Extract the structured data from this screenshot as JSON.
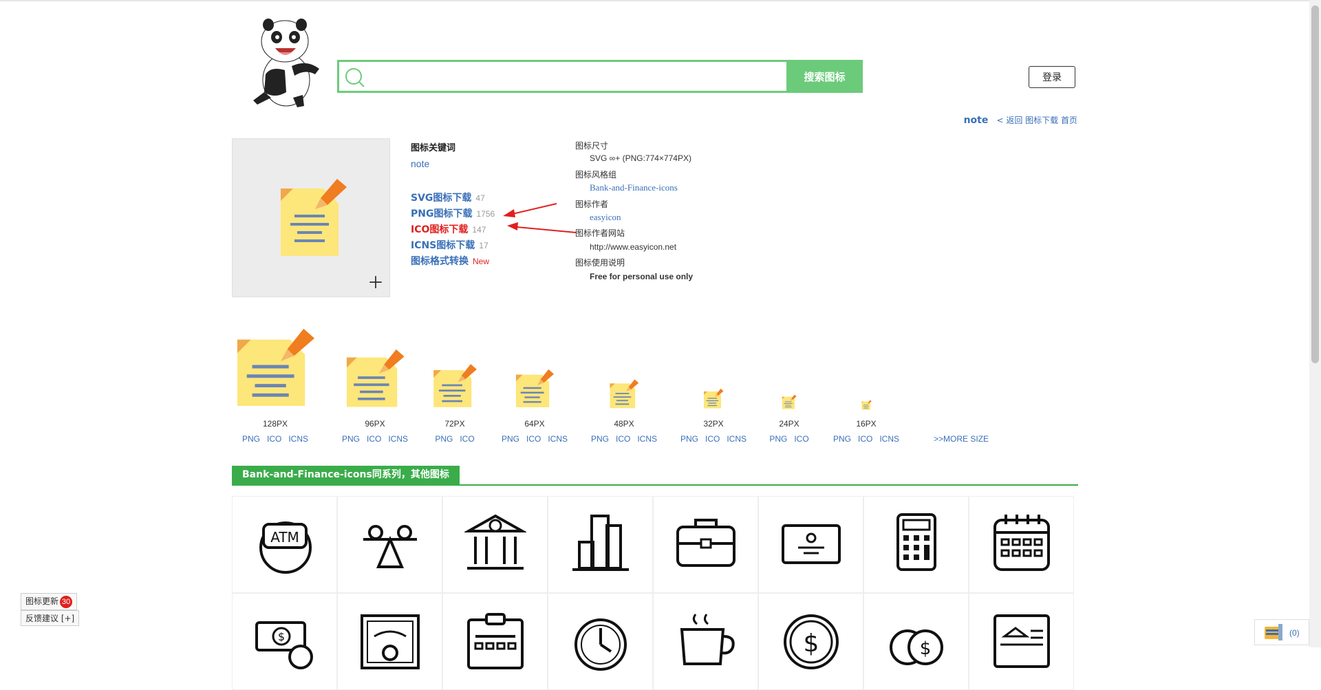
{
  "search": {
    "placeholder": "",
    "button_label": "搜索图标"
  },
  "header": {
    "login_label": "登录"
  },
  "breadcrumb": {
    "keyword": "note",
    "back_label": "< 返回 图标下载 首页"
  },
  "keyword_section": {
    "title": "图标关键词",
    "value": "note",
    "downloads": [
      {
        "label": "SVG图标下载",
        "count": "47"
      },
      {
        "label": "PNG图标下载",
        "count": "1756"
      },
      {
        "label": "ICO图标下载",
        "count": "147"
      },
      {
        "label": "ICNS图标下载",
        "count": "17"
      },
      {
        "label": "图标格式转换",
        "count": "New"
      }
    ]
  },
  "info": {
    "size_label": "图标尺寸",
    "size_value": "SVG ∞+ (PNG:774×774PX)",
    "style_label": "图标风格组",
    "style_value": "Bank-and-Finance-icons",
    "author_label": "图标作者",
    "author_value": "easyicon",
    "site_label": "图标作者网站",
    "site_value": "http://www.easyicon.net",
    "usage_label": "图标使用说明",
    "usage_value": "Free for personal use only"
  },
  "sizes": [
    {
      "label": "128PX",
      "formats": [
        "PNG",
        "ICO",
        "ICNS"
      ]
    },
    {
      "label": "96PX",
      "formats": [
        "PNG",
        "ICO",
        "ICNS"
      ]
    },
    {
      "label": "72PX",
      "formats": [
        "PNG",
        "ICO"
      ]
    },
    {
      "label": "64PX",
      "formats": [
        "PNG",
        "ICO",
        "ICNS"
      ]
    },
    {
      "label": "48PX",
      "formats": [
        "PNG",
        "ICO",
        "ICNS"
      ]
    },
    {
      "label": "32PX",
      "formats": [
        "PNG",
        "ICO",
        "ICNS"
      ]
    },
    {
      "label": "24PX",
      "formats": [
        "PNG",
        "ICO"
      ]
    },
    {
      "label": "16PX",
      "formats": [
        "PNG",
        "ICO",
        "ICNS"
      ]
    }
  ],
  "more_size_label": ">>MORE SIZE",
  "series": {
    "title": "Bank-and-Finance-icons同系列，其他图标"
  },
  "related_icons": [
    "atm-icon",
    "seesaw-icon",
    "bank-bitcoin-icon",
    "bar-chart-icon",
    "briefcase-icon",
    "card-icon",
    "calculator-icon",
    "calendar-icon",
    "money-coin-icon",
    "certificate-icon",
    "clipboard-icon",
    "clock-coin-icon",
    "coffee-cup-icon",
    "dollar-coin-icon",
    "coins-icon",
    "bank-card-icon"
  ],
  "side": {
    "updates_label": "图标更新",
    "updates_count": "30",
    "feedback_label": "反馈建议 [+]"
  },
  "cart": {
    "count": "(0)"
  },
  "colors": {
    "green": "#6ccb7a",
    "tab_green": "#3aac4a",
    "link": "#3a6fb7",
    "red": "#e0201e"
  }
}
